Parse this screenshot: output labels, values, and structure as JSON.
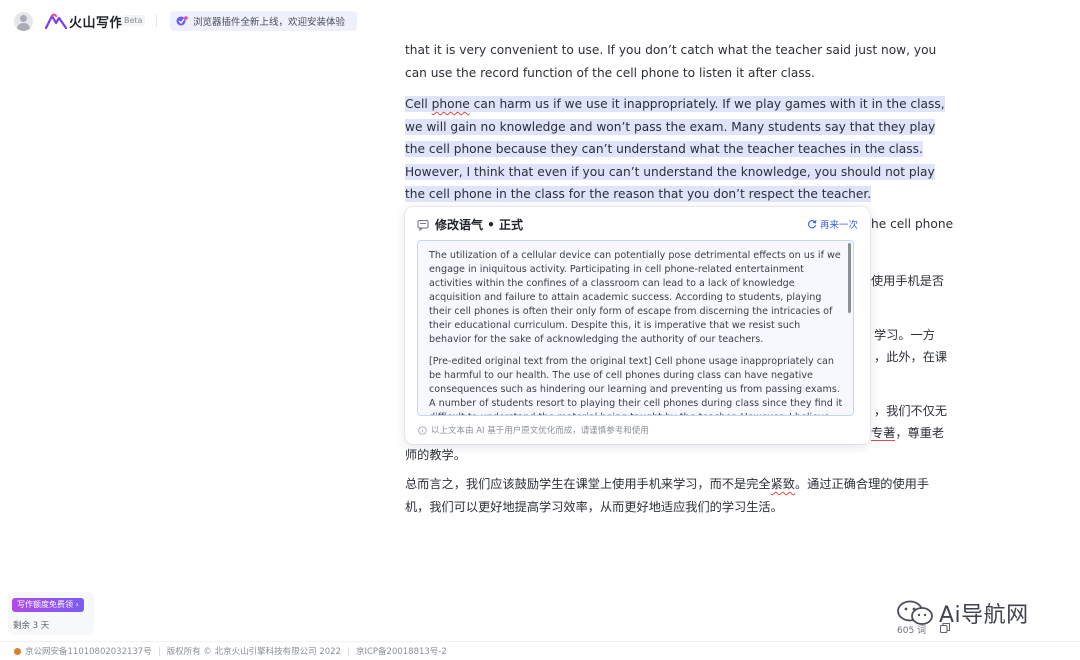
{
  "header": {
    "brand": "火山写作",
    "beta": "Beta",
    "announcement": "浏览器插件全新上线，欢迎安装体验"
  },
  "document": {
    "p1": "that it is very convenient to use. If you don’t catch what the teacher said just now, you can use the record function of the cell phone to listen it after class.",
    "p2_pre": "Cell ",
    "p2_word": "phone",
    "p2_post": " can harm us if we use it inappropriately. If we play games with it in the class, we will gain no knowledge and won’t pass the exam. Many students say that they play the cell phone because they can’t understand what the teacher teaches in the class. However, I think that even if you can’t understand the knowledge, you should not play the cell phone in the class for the reason that you don’t respect the teacher.",
    "frag_cellphone": "he cell phone",
    "frag_cn1": "使用手机是否",
    "frag_cn2": "学习。一方",
    "frag_cn3": "，此外，在课",
    "frag_cn4": "，我们不仅无",
    "frag_cn5_red": "专著",
    "frag_cn5_post": "，尊重老",
    "p_cn_end": "师的教学。",
    "p_cn_final_pre": "总而言之，我们应该鼓励学生在课堂上使用手机来学习，而不是完全",
    "p_cn_final_red": "紧致",
    "p_cn_final_post": "。通过正确合理的使用手机，我们可以更好地提高学习效率，从而更好地适应我们的学习生活。"
  },
  "popup": {
    "title": "修改语气 • 正式",
    "retry": "再来一次",
    "suggestion_1": "The utilization of a cellular device can potentially pose detrimental effects on us if we engage in iniquitous activity. Participating in cell phone-related entertainment activities within the confines of a classroom can lead to a lack of knowledge acquisition and failure to attain academic success. According to students, playing their cell phones is often their only form of escape from discerning the intricacies of their educational curriculum. Despite this, it is imperative that we resist such behavior for the sake of acknowledging the authority of our teachers.",
    "suggestion_2": "[Pre-edited original text from the original text] Cell phone usage inappropriately can be harmful to our health. The use of cell phones during class can have negative consequences such as hindering our learning and preventing us from passing exams. A number of students resort to playing their cell phones during class since they find it difficult to understand the material being taught by the teacher. However, I believe that",
    "disclaimer": "以上文本由 AI 基于用户原文优化而成，请谨慎参考和使用"
  },
  "quota": {
    "button": "写作额度免费领 ›",
    "remaining": "剩余 3 天"
  },
  "watermark": {
    "text": "Ai导航网"
  },
  "status": {
    "word_count": "605 词"
  },
  "footer": {
    "police": "京公网安备11010802032137号",
    "copyright": "版权所有 © 北京火山引擎科技有限公司 2022",
    "icp": "京ICP备20018813号-2"
  },
  "colors": {
    "highlight": "#dfe4fb",
    "accent": "#3d62e6",
    "error": "#e5484d"
  }
}
